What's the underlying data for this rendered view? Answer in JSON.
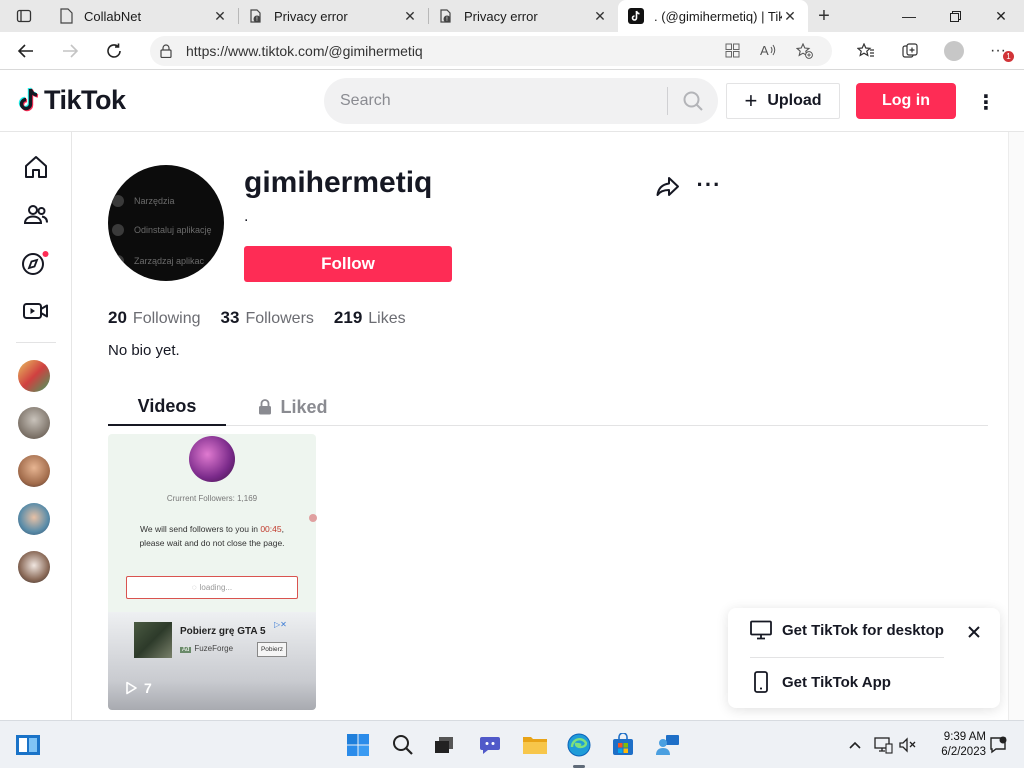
{
  "browser": {
    "tabs": [
      {
        "title": "CollabNet",
        "icon": "page-icon"
      },
      {
        "title": "Privacy error",
        "icon": "privacy-error-icon"
      },
      {
        "title": "Privacy error",
        "icon": "privacy-error-icon"
      },
      {
        "title": ". (@gimihermetiq) | TikTok",
        "icon": "tiktok-icon",
        "active": true
      }
    ],
    "url": "https://www.tiktok.com/@gimihermetiq",
    "notification_count": "1"
  },
  "tiktok": {
    "logo_text": "TikTok",
    "search_placeholder": "Search",
    "upload_label": "Upload",
    "login_label": "Log in",
    "accent_color": "#fe2c55"
  },
  "profile": {
    "username": "gimihermetiq",
    "nickname": ".",
    "follow_label": "Follow",
    "avatar_menu": [
      "Narzędzia",
      "Odinstaluj aplikację",
      "Zarządzaj aplikac"
    ],
    "stats": {
      "following_count": "20",
      "following_label": "Following",
      "followers_count": "33",
      "followers_label": "Followers",
      "likes_count": "219",
      "likes_label": "Likes"
    },
    "bio": "No bio yet.",
    "tabs": {
      "videos": "Videos",
      "liked": "Liked"
    }
  },
  "videos": [
    {
      "followers_text": "Crurrent Followers: 1,169",
      "message_line1": "We will send followers to you in",
      "timer": "00:45",
      "message_line2": "please wait and do not close the page.",
      "loading_text": "loading...",
      "ad_title": "Pobierz grę GTA 5",
      "ad_brand": "FuzeForge",
      "ad_button": "Pobierz",
      "views": "7"
    }
  ],
  "get_app": {
    "desktop_label": "Get TikTok for desktop",
    "app_label": "Get TikTok App"
  },
  "taskbar": {
    "time": "9:39 AM",
    "date": "6/2/2023"
  }
}
